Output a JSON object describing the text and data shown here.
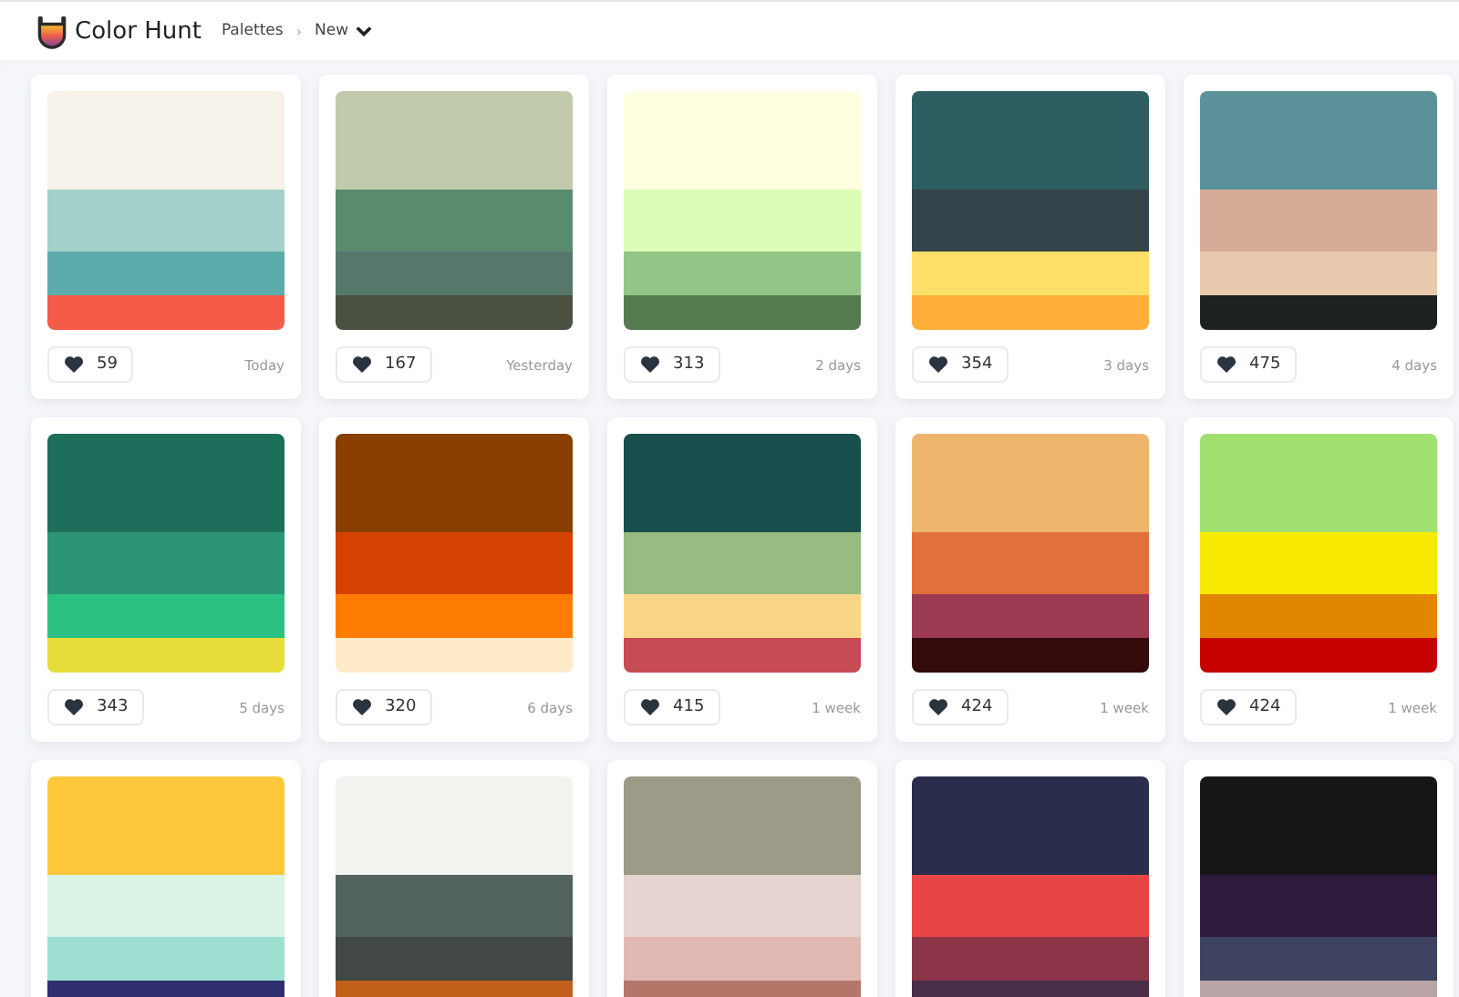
{
  "header": {
    "brand": "Color Hunt",
    "breadcrumb": [
      "Palettes"
    ],
    "separator": "›",
    "menu": {
      "label": "New"
    }
  },
  "palettes": [
    {
      "swatches": [
        {
          "color": "#f6f1e9"
        },
        {
          "color": "#a4d0cb"
        },
        {
          "color": "#5cacab"
        },
        {
          "color": "#f45b48"
        }
      ],
      "likes": "59",
      "time": "Today"
    },
    {
      "swatches": [
        {
          "color": "#c1cbab"
        },
        {
          "color": "#5a8b6e"
        },
        {
          "color": "#56786b"
        },
        {
          "color": "#4a5140"
        }
      ],
      "likes": "167",
      "time": "Yesterday"
    },
    {
      "swatches": [
        {
          "color": "#fefee0"
        },
        {
          "color": "#dcfdb6"
        },
        {
          "color": "#93c587"
        },
        {
          "color": "#567a50"
        }
      ],
      "likes": "313",
      "time": "2 days"
    },
    {
      "swatches": [
        {
          "color": "#2e5e62"
        },
        {
          "color": "#35444a"
        },
        {
          "color": "#fedf69"
        },
        {
          "color": "#feaf39"
        }
      ],
      "likes": "354",
      "time": "3 days"
    },
    {
      "swatches": [
        {
          "color": "#5b9299"
        },
        {
          "color": "#d6ac99"
        },
        {
          "color": "#e8c9ae"
        },
        {
          "color": "#1d2320"
        }
      ],
      "likes": "475",
      "time": "4 days"
    },
    {
      "swatches": [
        {
          "color": "#1e6e5c"
        },
        {
          "color": "#2b9575"
        },
        {
          "color": "#2bc183"
        },
        {
          "color": "#e6dd3b"
        }
      ],
      "likes": "343",
      "time": "5 days"
    },
    {
      "swatches": [
        {
          "color": "#8a3f00"
        },
        {
          "color": "#d54100"
        },
        {
          "color": "#ff7c04"
        },
        {
          "color": "#ffebc7"
        }
      ],
      "likes": "320",
      "time": "6 days"
    },
    {
      "swatches": [
        {
          "color": "#184e4b"
        },
        {
          "color": "#97bb80"
        },
        {
          "color": "#f9d587"
        },
        {
          "color": "#c64b54"
        }
      ],
      "likes": "415",
      "time": "1 week"
    },
    {
      "swatches": [
        {
          "color": "#edb56b"
        },
        {
          "color": "#e2703a"
        },
        {
          "color": "#9c3a51"
        },
        {
          "color": "#340a0b"
        }
      ],
      "likes": "424",
      "time": "1 week"
    },
    {
      "swatches": [
        {
          "color": "#a0e070"
        },
        {
          "color": "#f7ea00"
        },
        {
          "color": "#e28600"
        },
        {
          "color": "#c40000"
        }
      ],
      "likes": "424",
      "time": "1 week"
    },
    {
      "swatches": [
        {
          "color": "#fec73c"
        },
        {
          "color": "#daf4e6"
        },
        {
          "color": "#9de0d2"
        },
        {
          "color": "#2f2f6e"
        }
      ]
    },
    {
      "swatches": [
        {
          "color": "#f1f3ee"
        },
        {
          "color": "#52625f"
        },
        {
          "color": "#424843"
        },
        {
          "color": "#c1601a"
        }
      ]
    },
    {
      "swatches": [
        {
          "color": "#9c9b87"
        },
        {
          "color": "#e5d4d0"
        },
        {
          "color": "#e2b8b3"
        },
        {
          "color": "#b5766a"
        }
      ]
    },
    {
      "swatches": [
        {
          "color": "#2a2d4b"
        },
        {
          "color": "#e84545"
        },
        {
          "color": "#8c3549"
        },
        {
          "color": "#4b2e47"
        }
      ]
    },
    {
      "swatches": [
        {
          "color": "#161616"
        },
        {
          "color": "#2e1a3b"
        },
        {
          "color": "#3d4360"
        },
        {
          "color": "#b9a4a6"
        }
      ]
    }
  ]
}
